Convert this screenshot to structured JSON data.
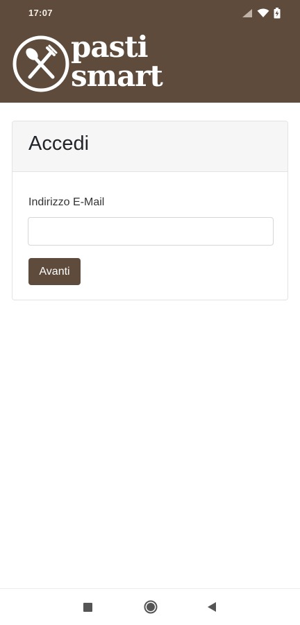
{
  "status_bar": {
    "time": "17:07",
    "icons": [
      "signal-icon",
      "wifi-icon",
      "battery-icon"
    ]
  },
  "header": {
    "logo_icon": "fork-spoon-icon",
    "logo_line1": "pasti",
    "logo_line2": "smart",
    "background": "#5e4b3c"
  },
  "login": {
    "title": "Accedi",
    "email_label": "Indirizzo E-Mail",
    "email_value": "",
    "email_placeholder": "",
    "next_label": "Avanti"
  },
  "nav_bar": {
    "buttons": [
      "recents-icon",
      "home-icon",
      "back-icon"
    ]
  },
  "colors": {
    "brand": "#5e4b3c",
    "card_header": "#f6f6f6"
  }
}
